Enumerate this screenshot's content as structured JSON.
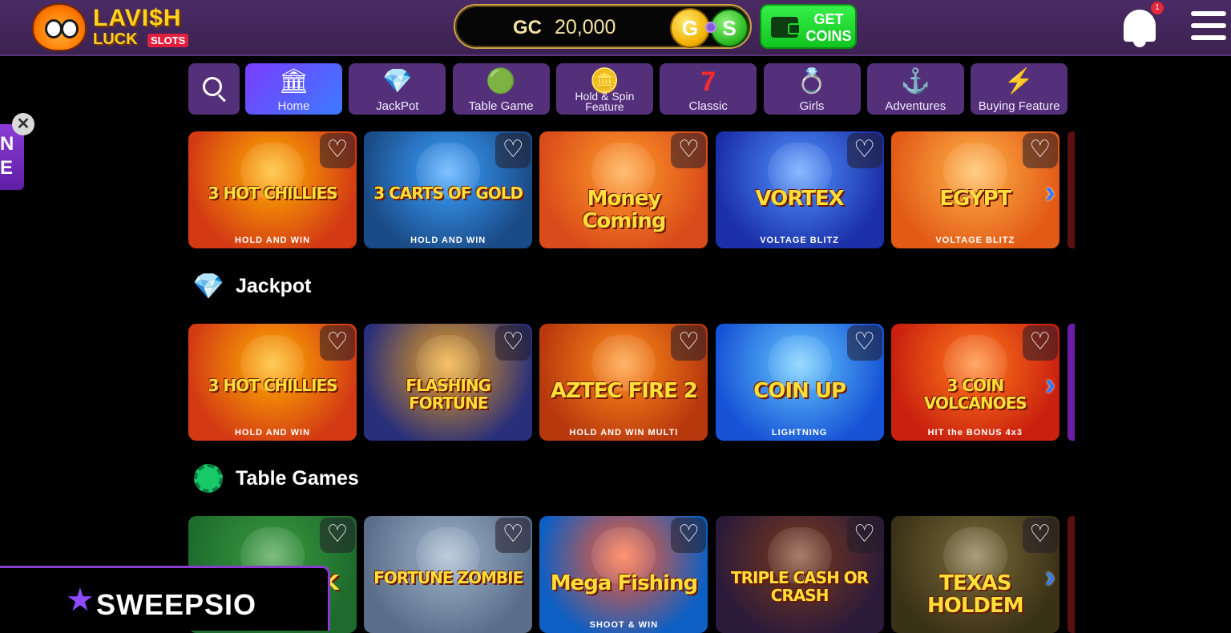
{
  "header": {
    "logo": {
      "line1": "LAVI$H",
      "line2": "LUCK",
      "badge": "SLOTS"
    },
    "balance": {
      "currency": "GC",
      "amount": "20,000",
      "coin_g": "G",
      "coin_s": "S"
    },
    "get_coins": "GET COINS",
    "notification_count": "1"
  },
  "categories": [
    {
      "label": "Home",
      "icon": "bank-icon",
      "glyph": "🏛",
      "active": true
    },
    {
      "label": "JackPot",
      "icon": "diamond-icon",
      "glyph": "💎"
    },
    {
      "label": "Table Game",
      "icon": "chip-icon",
      "glyph": "🟢"
    },
    {
      "label": "Hold & Spin Feature",
      "icon": "coins-stack-icon",
      "glyph": "🪙"
    },
    {
      "label": "Classic",
      "icon": "seven-icon",
      "glyph": "7"
    },
    {
      "label": "Girls",
      "icon": "ring-icon",
      "glyph": "💍"
    },
    {
      "label": "Adventures",
      "icon": "anchor-icon",
      "glyph": "⚓"
    },
    {
      "label": "Buying Feature",
      "icon": "lightning-icon",
      "glyph": "⚡"
    }
  ],
  "sections": {
    "row1": {
      "games": [
        {
          "title": "3 HOT CHILLIES",
          "sub": "HOLD AND WIN",
          "bg": "#d33a14",
          "bg2": "#ffb000"
        },
        {
          "title": "3 CARTS OF GOLD",
          "sub": "HOLD AND WIN",
          "bg": "#1a4b86",
          "bg2": "#3aa0ff"
        },
        {
          "title": "Money Coming",
          "sub": "",
          "bg": "#d94b1a",
          "bg2": "#ff9b2a"
        },
        {
          "title": "VORTEX",
          "sub": "VOLTAGE BLITZ",
          "bg": "#1b2fa8",
          "bg2": "#4f93ff"
        },
        {
          "title": "EGYPT",
          "sub": "VOLTAGE BLITZ",
          "bg": "#e25a16",
          "bg2": "#ffb347"
        }
      ]
    },
    "jackpot": {
      "title": "Jackpot",
      "games": [
        {
          "title": "3 HOT CHILLIES",
          "sub": "HOLD AND WIN",
          "bg": "#d33a14",
          "bg2": "#ffb000"
        },
        {
          "title": "FLASHING FORTUNE",
          "sub": "",
          "bg": "#2a2f7a",
          "bg2": "#f0a21a"
        },
        {
          "title": "AZTEC FIRE 2",
          "sub": "HOLD AND WIN MULTI",
          "bg": "#b8380e",
          "bg2": "#ff8d1a"
        },
        {
          "title": "COIN UP",
          "sub": "LIGHTNING",
          "bg": "#1753d6",
          "bg2": "#63c7ff"
        },
        {
          "title": "3 COIN VOLCANOES",
          "sub": "HIT the BONUS 4x3",
          "bg": "#c9200f",
          "bg2": "#ff7a1a"
        }
      ]
    },
    "table_games": {
      "title": "Table Games",
      "games": [
        {
          "title": "BLACK JACK",
          "sub": "",
          "bg": "#1d6b2d",
          "bg2": "#3a9a3e"
        },
        {
          "title": "FORTUNE ZOMBIE",
          "sub": "",
          "bg": "#5a6e8a",
          "bg2": "#9db3c9"
        },
        {
          "title": "Mega Fishing",
          "sub": "SHOOT & WIN",
          "bg": "#0d5fc4",
          "bg2": "#ff5a2a"
        },
        {
          "title": "TRIPLE CASH OR CRASH",
          "sub": "",
          "bg": "#2b1a3a",
          "bg2": "#7a3a1a"
        },
        {
          "title": "TEXAS HOLDEM",
          "sub": "",
          "bg": "#3a3216",
          "bg2": "#7a6a3a"
        }
      ]
    }
  },
  "side_promo": {
    "text": "N\nE",
    "close": "✕"
  },
  "watermark": {
    "text": "SWEEPSIO"
  },
  "colors": {
    "header_bg": "#3c2252",
    "category_bg": "#55307a",
    "active_tab": "#7b3cff",
    "get_coins": "#11c41f",
    "accent_blue": "#2d7bff"
  }
}
